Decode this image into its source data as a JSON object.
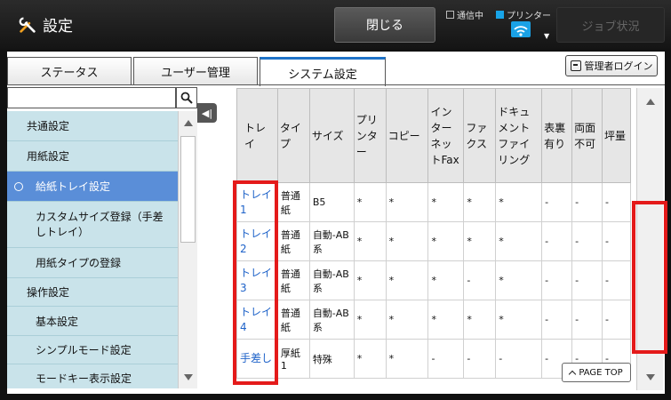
{
  "header": {
    "title": "設定",
    "close_label": "閉じる",
    "status_comm": "通信中",
    "status_printer": "プリンター",
    "job_status": "ジョブ状況"
  },
  "tabs": [
    {
      "label": "ステータス"
    },
    {
      "label": "ユーザー管理"
    },
    {
      "label": "システム設定",
      "active": true
    }
  ],
  "admin_login": "管理者ログイン",
  "search": {
    "value": "",
    "placeholder": ""
  },
  "nav": {
    "items": [
      {
        "label": "共通設定",
        "kind": "group"
      },
      {
        "label": "用紙設定",
        "kind": "group"
      },
      {
        "label": "給紙トレイ設定",
        "kind": "sub",
        "selected": true
      },
      {
        "label": "カスタムサイズ登録（手差しトレイ）",
        "kind": "sub"
      },
      {
        "label": "用紙タイプの登録",
        "kind": "sub"
      },
      {
        "label": "操作設定",
        "kind": "group"
      },
      {
        "label": "基本設定",
        "kind": "sub"
      },
      {
        "label": "シンプルモード設定",
        "kind": "sub"
      },
      {
        "label": "モードキー表示設定",
        "kind": "sub"
      }
    ]
  },
  "table": {
    "headers": [
      "トレイ",
      "タイプ",
      "サイズ",
      "プリンター",
      "コピー",
      "インターネットFax",
      "ファクス",
      "ドキュメントファイリング",
      "表裏有り",
      "両面不可",
      "坪量"
    ],
    "rows": [
      [
        "トレイ1",
        "普通紙",
        "B5",
        "*",
        "*",
        "*",
        "*",
        "*",
        "-",
        "-",
        "-"
      ],
      [
        "トレイ2",
        "普通紙",
        "自動-AB系",
        "*",
        "*",
        "*",
        "*",
        "*",
        "-",
        "-",
        "-"
      ],
      [
        "トレイ3",
        "普通紙",
        "自動-AB系",
        "*",
        "*",
        "*",
        "-",
        "*",
        "-",
        "-",
        "-"
      ],
      [
        "トレイ4",
        "普通紙",
        "自動-AB系",
        "*",
        "*",
        "*",
        "*",
        "*",
        "-",
        "-",
        "-"
      ],
      [
        "手差し",
        "厚紙1",
        "特殊",
        "*",
        "*",
        "-",
        "-",
        "-",
        "-",
        "-",
        "-"
      ]
    ]
  },
  "page_top": "PAGE TOP",
  "colors": {
    "accent": "#1e73c8",
    "selected_nav": "#5a8ed8",
    "nav_bg": "#c9e3ea",
    "highlight": "#e41a1a"
  }
}
